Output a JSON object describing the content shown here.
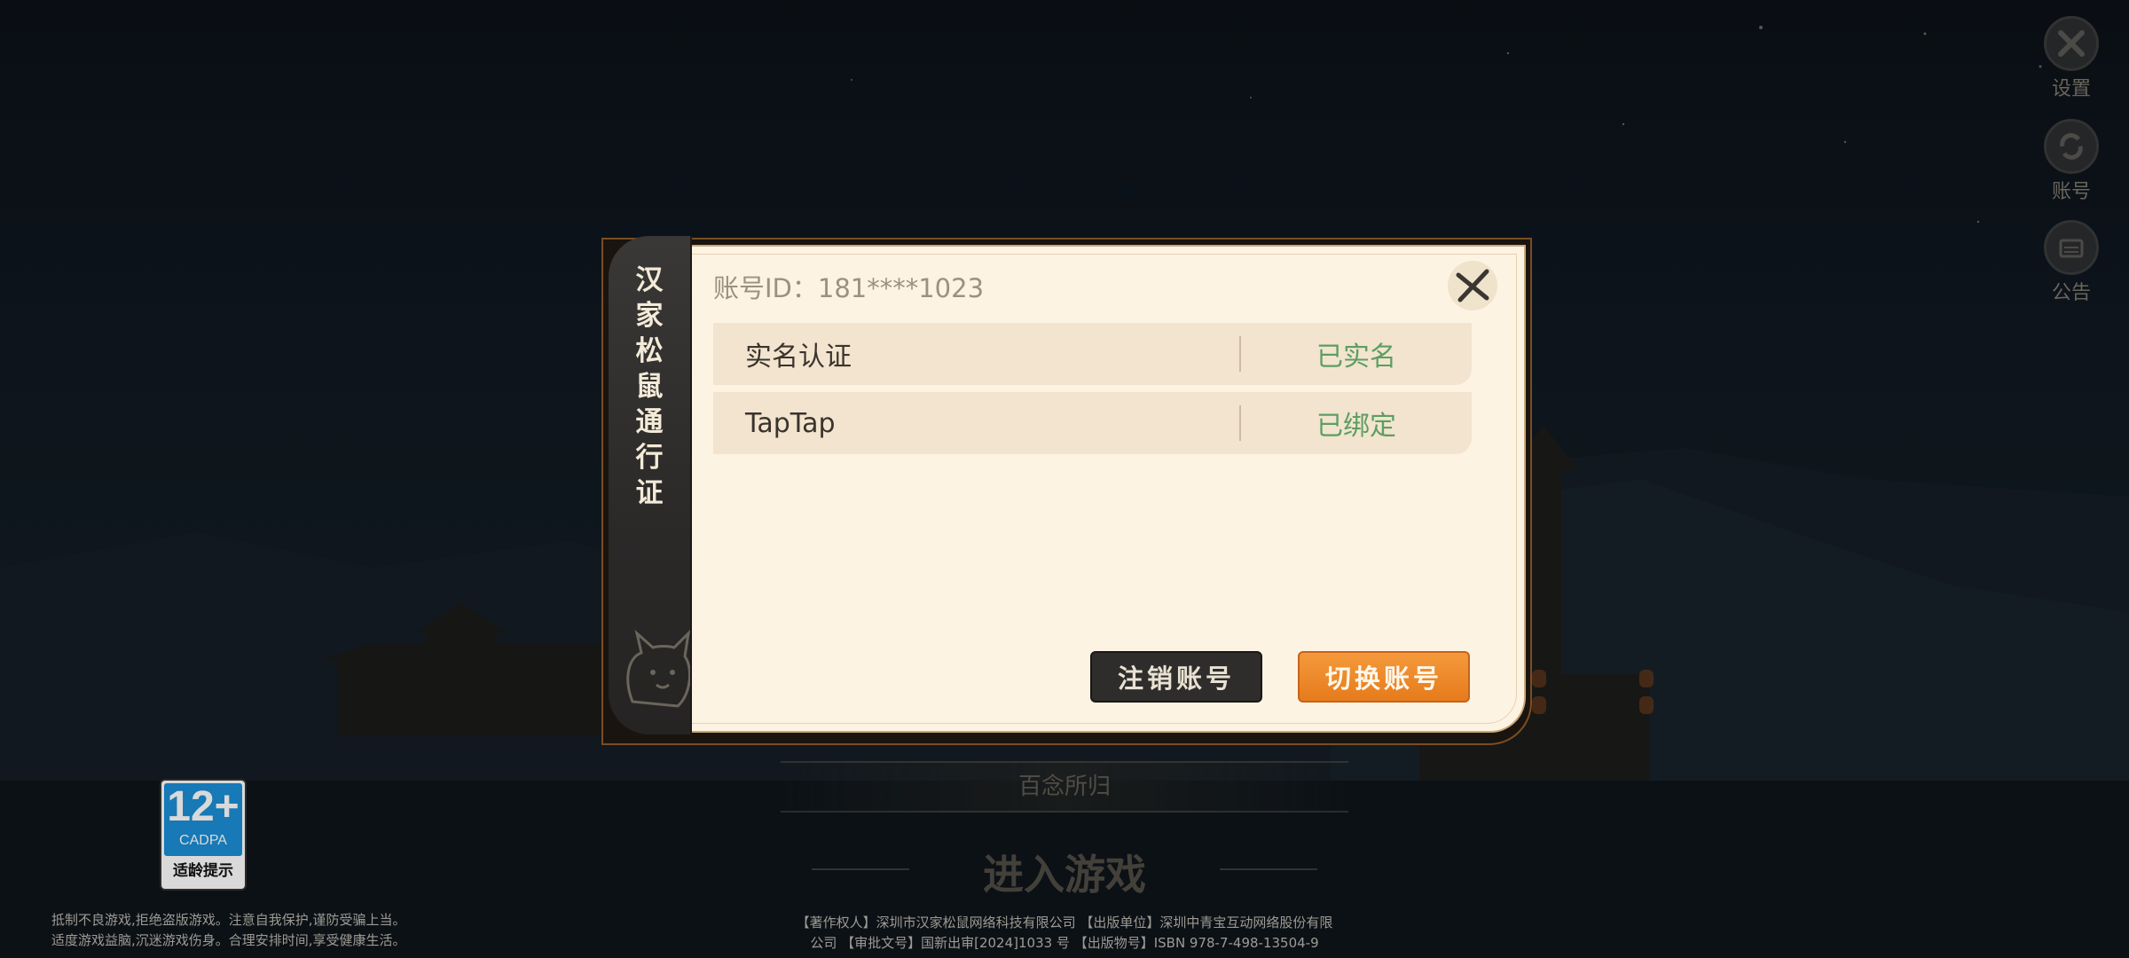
{
  "side_menu": {
    "settings": {
      "label": "设置",
      "icon": "wrench-cross-icon"
    },
    "account": {
      "label": "账号",
      "icon": "switch-cycle-icon"
    },
    "notice": {
      "label": "公告",
      "icon": "notice-board-icon"
    }
  },
  "background": {
    "input_text": "百念所归",
    "enter_game": "进入游戏",
    "legal_left_1": "抵制不良游戏,拒绝盗版游戏。注意自我保护,谨防受骗上当。",
    "legal_left_2": "适度游戏益脑,沉迷游戏伤身。合理安排时间,享受健康生活。",
    "legal_center_1": "【著作权人】深圳市汉家松鼠网络科技有限公司 【出版单位】深圳中青宝互动网络股份有限",
    "legal_center_2": "公司 【审批文号】国新出审[2024]1033 号 【出版物号】ISBN 978-7-498-13504-9"
  },
  "age_badge": {
    "rating": "12+",
    "org": "CADPA",
    "tip": "适龄提示",
    "color": "#1c8fd6"
  },
  "dialog": {
    "tab_title_chars": [
      "汉",
      "家",
      "松",
      "鼠",
      "通",
      "行",
      "证"
    ],
    "account_id": "账号ID：181****1023",
    "rows": [
      {
        "name": "实名认证",
        "status": "已实名"
      },
      {
        "name": "TapTap",
        "status": "已绑定"
      }
    ],
    "logout_label": "注销账号",
    "switch_label": "切换账号",
    "status_color": "#5d9e62",
    "accent_color": "#f0892e"
  }
}
